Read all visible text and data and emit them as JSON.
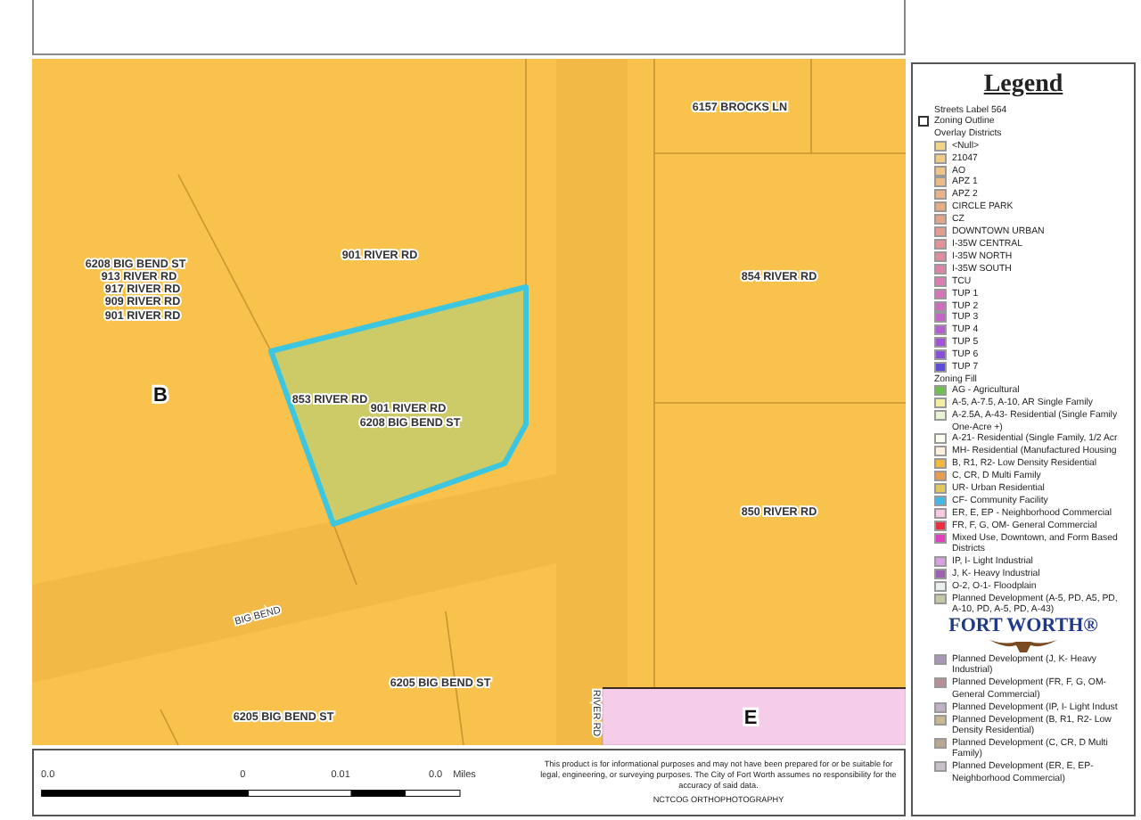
{
  "map": {
    "zone_labels": [
      "B",
      "E"
    ],
    "address_labels": [
      "6157 BROCKS LN",
      "854 RIVER RD",
      "901 RIVER RD",
      "6208 BIG BEND ST",
      "913 RIVER RD",
      "917 RIVER RD",
      "909 RIVER RD",
      "901 RIVER RD",
      "853 RIVER RD",
      "901 RIVER RD",
      "6208 BIG BEND ST",
      "850 RIVER RD",
      "6205 BIG BEND ST",
      "6205 BIG BEND ST"
    ],
    "street_labels": [
      "BIG BEND",
      "RIVER RD"
    ]
  },
  "scale_bar": {
    "ticks": [
      "0.0",
      "0",
      "0.01",
      "0.0"
    ],
    "unit": "Miles"
  },
  "disclaimer": "This product is for informational purposes and may not have been prepared for or be suitable for legal, engineering, or surveying purposes. The City of Fort Worth assumes no responsibility for the accuracy of said data.",
  "source": "NCTCOG ORTHOPHOTOGRAPHY",
  "legend": {
    "title": "Legend",
    "items": [
      {
        "kind": "heading",
        "label": "Streets Label 564"
      },
      {
        "kind": "outline",
        "label": "Zoning Outline"
      },
      {
        "kind": "heading",
        "label": "Overlay Districts"
      },
      {
        "kind": "swatch",
        "label": "<Null>",
        "color": "#f0d488"
      },
      {
        "kind": "swatch",
        "label": "21047",
        "color": "#f0cc88"
      },
      {
        "kind": "swatch",
        "label": "AO",
        "color": "#eec488"
      },
      {
        "kind": "swatch",
        "label": "APZ 1",
        "color": "#ecbc88"
      },
      {
        "kind": "swatch",
        "label": "APZ 2",
        "color": "#eab488"
      },
      {
        "kind": "swatch",
        "label": "CIRCLE PARK",
        "color": "#e8ac88"
      },
      {
        "kind": "swatch",
        "label": "CZ",
        "color": "#e6a488"
      },
      {
        "kind": "swatch",
        "label": "DOWNTOWN URBAN",
        "color": "#e49c90"
      },
      {
        "kind": "swatch",
        "label": "I-35W CENTRAL",
        "color": "#e29498"
      },
      {
        "kind": "swatch",
        "label": "I-35W NORTH",
        "color": "#e08ca0"
      },
      {
        "kind": "swatch",
        "label": "I-35W SOUTH",
        "color": "#de84a8"
      },
      {
        "kind": "swatch",
        "label": "TCU",
        "color": "#dc7cb0"
      },
      {
        "kind": "swatch",
        "label": "TUP 1",
        "color": "#d874b8"
      },
      {
        "kind": "swatch",
        "label": "TUP 2",
        "color": "#d06cc0"
      },
      {
        "kind": "swatch",
        "label": "TUP 3",
        "color": "#c464c8"
      },
      {
        "kind": "swatch",
        "label": "TUP 4",
        "color": "#b45cd0"
      },
      {
        "kind": "swatch",
        "label": "TUP 5",
        "color": "#a054d4"
      },
      {
        "kind": "swatch",
        "label": "TUP 6",
        "color": "#8850d8"
      },
      {
        "kind": "swatch",
        "label": "TUP 7",
        "color": "#5c4cd8"
      },
      {
        "kind": "heading",
        "label": "Zoning Fill"
      },
      {
        "kind": "swatch",
        "label": "AG - Agricultural",
        "color": "#6cc24a"
      },
      {
        "kind": "swatch",
        "label": "A-5, A-7.5, A-10, AR Single Family",
        "color": "#f2f0a0"
      },
      {
        "kind": "swatch",
        "label": "A-2.5A, A-43- Residential (Single Family One-Acre +)",
        "color": "#e8f4d4"
      },
      {
        "kind": "swatch",
        "label": "A-21- Residential (Single Family, 1/2 Acr",
        "color": "#fdfdf4"
      },
      {
        "kind": "swatch",
        "label": "MH- Residential (Manufactured Housing",
        "color": "#fff0dc"
      },
      {
        "kind": "swatch",
        "label": "B, R1, R2- Low Density Residential",
        "color": "#f5b840"
      },
      {
        "kind": "swatch",
        "label": "C, CR, D Multi Family",
        "color": "#e89c50"
      },
      {
        "kind": "swatch",
        "label": "UR- Urban Residential",
        "color": "#e0c860"
      },
      {
        "kind": "swatch",
        "label": "CF- Community Facility",
        "color": "#40b8e8"
      },
      {
        "kind": "swatch",
        "label": "ER, E, EP - Neighborhood Commercial",
        "color": "#f8c8e0"
      },
      {
        "kind": "swatch",
        "label": "FR, F, G, OM- General Commercial",
        "color": "#e83040"
      },
      {
        "kind": "swatch",
        "label": "Mixed Use, Downtown, and Form Based Districts",
        "color": "#e040c0"
      },
      {
        "kind": "swatch",
        "label": "IP, I- Light Industrial",
        "color": "#d8a0e0"
      },
      {
        "kind": "swatch",
        "label": "J, K- Heavy Industrial",
        "color": "#a060b0"
      },
      {
        "kind": "swatch",
        "label": "O-2, O-1- Floodplain",
        "color": "#e8f0f0"
      },
      {
        "kind": "swatch",
        "label": "Planned Development (A-5, PD, A5, PD, A-10, PD, A-5, PD, A-43)",
        "color": "#c8c8a8"
      },
      {
        "kind": "logo",
        "label": "FORT WORTH®"
      },
      {
        "kind": "swatch",
        "label": "Planned Development (J, K- Heavy Industrial)",
        "color": "#a898b8"
      },
      {
        "kind": "swatch",
        "label": "Planned Development (FR, F, G, OM- General Commercial)",
        "color": "#b89098"
      },
      {
        "kind": "swatch",
        "label": "Planned Development (IP, I- Light Indust",
        "color": "#c0b0c8"
      },
      {
        "kind": "swatch",
        "label": "Planned Development (B, R1, R2- Low Density Residential)",
        "color": "#c8b890"
      },
      {
        "kind": "swatch",
        "label": "Planned Development (C, CR, D Multi Family)",
        "color": "#b8a890"
      },
      {
        "kind": "swatch",
        "label": "Planned Development (ER, E, EP- Neighborhood Commercial)",
        "color": "#c8c0c8"
      }
    ]
  }
}
